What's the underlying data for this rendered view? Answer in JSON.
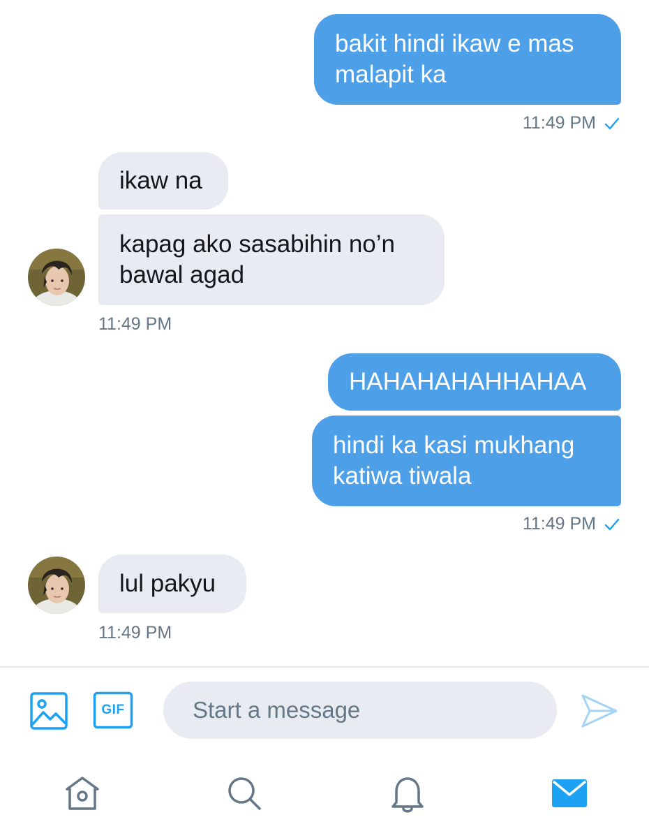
{
  "messages": [
    {
      "text": "bakit hindi ikaw e mas\nmalapit ka"
    },
    {
      "text": "ikaw na"
    },
    {
      "text": "kapag ako sasabihin no’n\nbawal agad"
    },
    {
      "text": "HAHAHAHAHHAHAA"
    },
    {
      "text": "hindi ka kasi mukhang\nkatiwa tiwala"
    },
    {
      "text": "lul pakyu"
    }
  ],
  "timestamps": [
    "11:49 PM",
    "11:49 PM",
    "11:49 PM",
    "11:49 PM"
  ],
  "composer": {
    "placeholder": "Start a message",
    "gif_label": "GIF"
  },
  "icons": {
    "image": "image-icon",
    "gif": "gif-icon",
    "send": "send-icon",
    "home": "home-icon",
    "search": "search-icon",
    "notifications": "bell-icon",
    "messages": "mail-icon",
    "read_receipt": "checkmark-icon"
  },
  "colors": {
    "outgoing_bubble": "#4d9fe8",
    "incoming_bubble": "#e8ecf2",
    "accent": "#1da1f2",
    "muted_text": "#657786"
  }
}
